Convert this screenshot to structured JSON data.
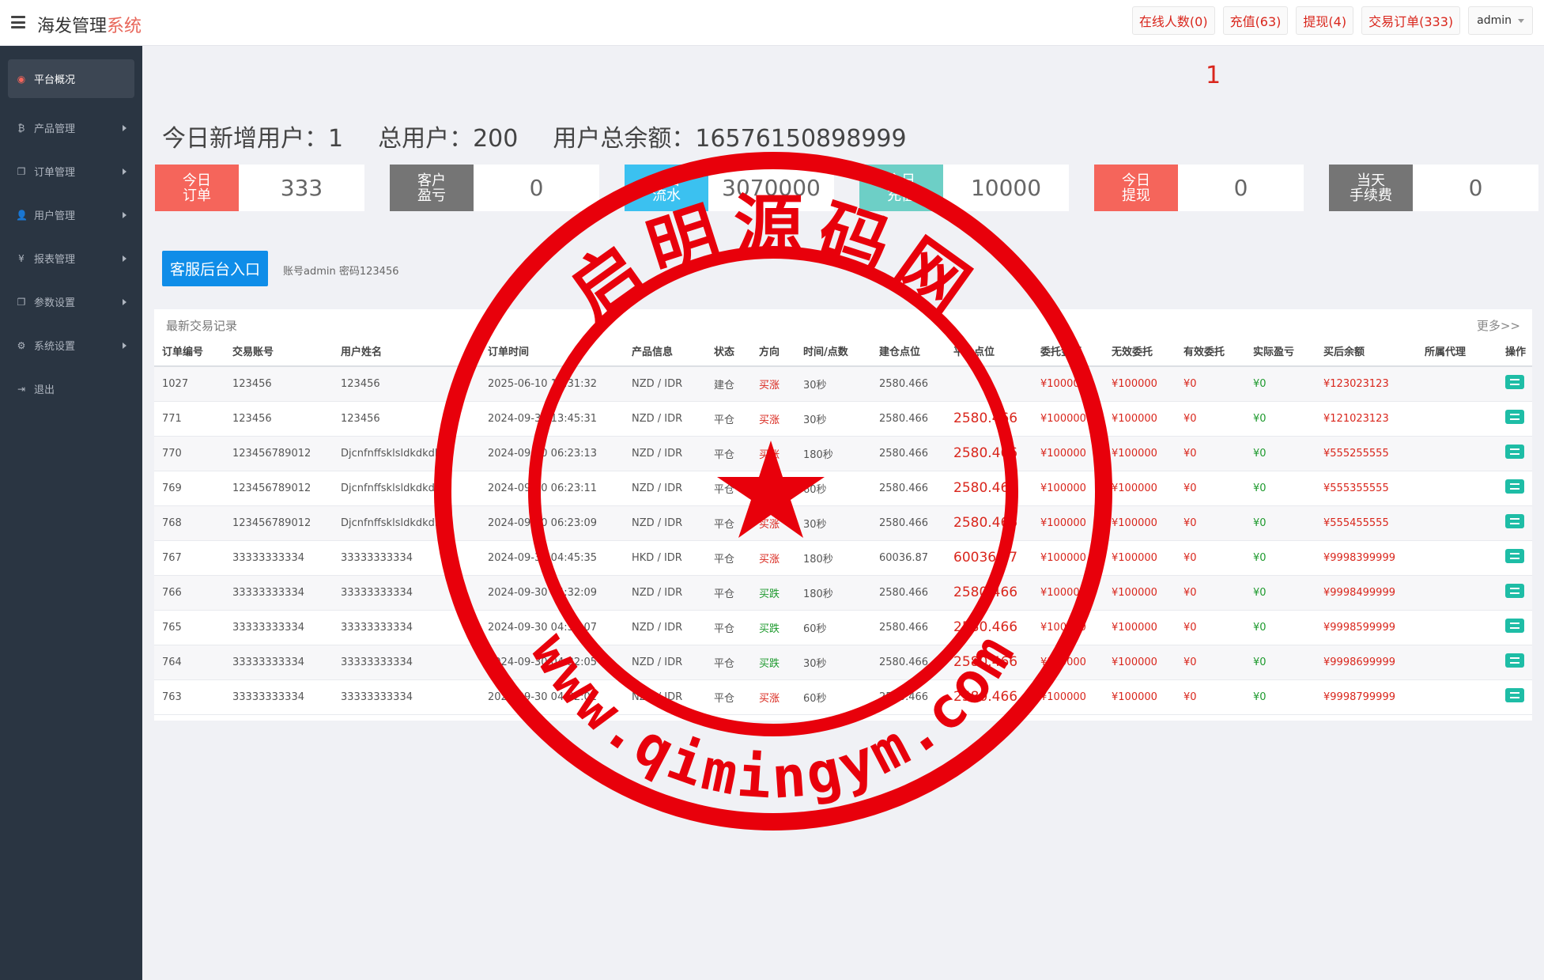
{
  "header": {
    "brand_main": "海发管理",
    "brand_accent": "系统",
    "buttons": [
      "在线人数(0)",
      "充值(63)",
      "提现(4)",
      "交易订单(333)"
    ],
    "user": "admin"
  },
  "sidebar": {
    "items": [
      {
        "label": "平台概况",
        "icon": "dashboard-icon",
        "glyph": "◉"
      },
      {
        "label": "产品管理",
        "icon": "bitcoin-icon",
        "glyph": "₿"
      },
      {
        "label": "订单管理",
        "icon": "copy-icon",
        "glyph": "❐"
      },
      {
        "label": "用户管理",
        "icon": "user-icon",
        "glyph": "👤"
      },
      {
        "label": "报表管理",
        "icon": "yen-icon",
        "glyph": "¥"
      },
      {
        "label": "参数设置",
        "icon": "copy-icon",
        "glyph": "❐"
      },
      {
        "label": "系统设置",
        "icon": "gears-icon",
        "glyph": "⚙"
      },
      {
        "label": "退出",
        "icon": "sign-out-icon",
        "glyph": "⇥"
      }
    ]
  },
  "main": {
    "red_number": "1",
    "summary": {
      "new_users": "今日新增用户：1",
      "total_users": "总用户：200",
      "total_balance": "用户总余额：16576150898999"
    },
    "stats": [
      {
        "label1": "今日",
        "label2": "订单",
        "value": "333",
        "color": "#f5655b"
      },
      {
        "label1": "客户",
        "label2": "盈亏",
        "value": "0",
        "color": "#757575"
      },
      {
        "label1": "今日",
        "label2": "流水",
        "value": "3070000",
        "color": "#3bc1f0"
      },
      {
        "label1": "今日",
        "label2": "充值",
        "value": "10000",
        "color": "#6dcfc6"
      },
      {
        "label1": "今日",
        "label2": "提现",
        "value": "0",
        "color": "#f5655b"
      },
      {
        "label1": "当天",
        "label2": "手续费",
        "value": "0",
        "color": "#757575"
      }
    ],
    "service_button": "客服后台入口",
    "service_note": "账号admin 密码123456",
    "panel_title": "最新交易记录",
    "panel_more": "更多>>",
    "columns": [
      "订单编号",
      "交易账号",
      "用户姓名",
      "订单时间",
      "产品信息",
      "状态",
      "方向",
      "时间/点数",
      "建仓点位",
      "平仓点位",
      "委托金额",
      "无效委托",
      "有效委托",
      "实际盈亏",
      "买后余额",
      "所属代理",
      "操作"
    ],
    "rows": [
      [
        "1027",
        "123456",
        "123456",
        "2025-06-10 11:31:32",
        "NZD / IDR",
        "建仓",
        "买涨",
        "30秒",
        "2580.466",
        "",
        "¥100000",
        "¥100000",
        "¥0",
        "¥0",
        "¥123023123",
        ""
      ],
      [
        "771",
        "123456",
        "123456",
        "2024-09-30 13:45:31",
        "NZD / IDR",
        "平仓",
        "买涨",
        "30秒",
        "2580.466",
        "2580.466",
        "¥100000",
        "¥100000",
        "¥0",
        "¥0",
        "¥121023123",
        ""
      ],
      [
        "770",
        "123456789012",
        "Djcnfnffsklsldkdkdkd",
        "2024-09-30 06:23:13",
        "NZD / IDR",
        "平仓",
        "买涨",
        "180秒",
        "2580.466",
        "2580.466",
        "¥100000",
        "¥100000",
        "¥0",
        "¥0",
        "¥555255555",
        ""
      ],
      [
        "769",
        "123456789012",
        "Djcnfnffsklsldkdkdkd",
        "2024-09-30 06:23:11",
        "NZD / IDR",
        "平仓",
        "买涨",
        "60秒",
        "2580.466",
        "2580.466",
        "¥100000",
        "¥100000",
        "¥0",
        "¥0",
        "¥555355555",
        ""
      ],
      [
        "768",
        "123456789012",
        "Djcnfnffsklsldkdkdkd",
        "2024-09-30 06:23:09",
        "NZD / IDR",
        "平仓",
        "买涨",
        "30秒",
        "2580.466",
        "2580.466",
        "¥100000",
        "¥100000",
        "¥0",
        "¥0",
        "¥555455555",
        ""
      ],
      [
        "767",
        "33333333334",
        "33333333334",
        "2024-09-30 04:45:35",
        "HKD / IDR",
        "平仓",
        "买涨",
        "180秒",
        "60036.87",
        "60036.87",
        "¥100000",
        "¥100000",
        "¥0",
        "¥0",
        "¥9998399999",
        ""
      ],
      [
        "766",
        "33333333334",
        "33333333334",
        "2024-09-30 04:32:09",
        "NZD / IDR",
        "平仓",
        "买跌",
        "180秒",
        "2580.466",
        "2580.466",
        "¥100000",
        "¥100000",
        "¥0",
        "¥0",
        "¥9998499999",
        ""
      ],
      [
        "765",
        "33333333334",
        "33333333334",
        "2024-09-30 04:32:07",
        "NZD / IDR",
        "平仓",
        "买跌",
        "60秒",
        "2580.466",
        "2580.466",
        "¥100000",
        "¥100000",
        "¥0",
        "¥0",
        "¥9998599999",
        ""
      ],
      [
        "764",
        "33333333334",
        "33333333334",
        "2024-09-30 04:32:05",
        "NZD / IDR",
        "平仓",
        "买跌",
        "30秒",
        "2580.466",
        "2580.466",
        "¥100000",
        "¥100000",
        "¥0",
        "¥0",
        "¥9998699999",
        ""
      ],
      [
        "763",
        "33333333334",
        "33333333334",
        "2024-09-30 04:32:01",
        "NZD / IDR",
        "平仓",
        "买涨",
        "60秒",
        "2580.466",
        "2580.466",
        "¥100000",
        "¥100000",
        "¥0",
        "¥0",
        "¥9998799999",
        ""
      ]
    ]
  },
  "watermark": {
    "top_text": "启明源码网",
    "bottom_text": "www.qimingym.com",
    "color": "#e8000b"
  }
}
